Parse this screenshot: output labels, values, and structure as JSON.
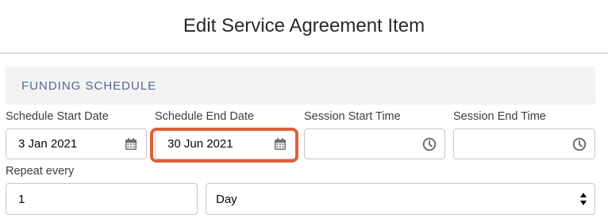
{
  "header": {
    "title": "Edit Service Agreement Item"
  },
  "section": {
    "title": "FUNDING SCHEDULE"
  },
  "fields": {
    "schedule_start_date": {
      "label": "Schedule Start Date",
      "value": "3 Jan 2021"
    },
    "schedule_end_date": {
      "label": "Schedule End Date",
      "value": "30 Jun 2021"
    },
    "session_start_time": {
      "label": "Session Start Time",
      "value": ""
    },
    "session_end_time": {
      "label": "Session End Time",
      "value": ""
    },
    "repeat_every": {
      "label": "Repeat every",
      "value": "1"
    },
    "repeat_unit": {
      "value": "Day"
    }
  },
  "colors": {
    "highlight": "#d9623a",
    "section_bg": "#f3f3f3",
    "section_text": "#54698d"
  }
}
